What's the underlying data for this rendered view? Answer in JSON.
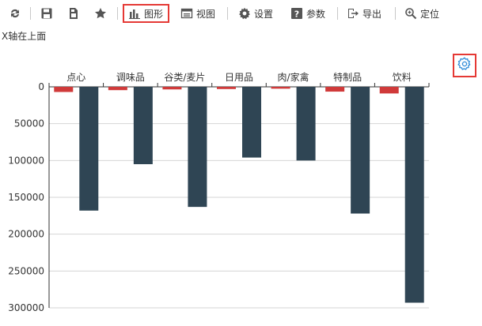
{
  "toolbar": {
    "refresh_icon": "refresh-icon",
    "save_icon": "save-icon",
    "save_as_icon": "save-as-icon",
    "favorite_icon": "star-icon",
    "chart_label": "图形",
    "view_label": "视图",
    "settings_label": "设置",
    "params_label": "参数",
    "export_label": "导出",
    "locate_label": "定位",
    "active_item": "图形"
  },
  "subtitle": "X轴在上面",
  "colors": {
    "series_a": "#d03a3a",
    "series_b": "#2f4554",
    "highlight": "#e53935",
    "gear": "#2e8bd8"
  },
  "chart_data": {
    "type": "bar",
    "x_axis_position": "top",
    "categories": [
      "点心",
      "调味品",
      "谷类/麦片",
      "日用品",
      "肉/家禽",
      "特制品",
      "饮料"
    ],
    "series": [
      {
        "values": [
          7000,
          4500,
          3500,
          3000,
          2500,
          6500,
          9000
        ]
      },
      {
        "values": [
          168000,
          105000,
          163000,
          96000,
          100000,
          172000,
          293000
        ]
      }
    ],
    "ylim": [
      0,
      300000
    ],
    "yticks": [
      0,
      50000,
      100000,
      150000,
      200000,
      250000,
      300000
    ],
    "y_inverted": true,
    "grid": true,
    "title": "",
    "xlabel": "",
    "ylabel": ""
  }
}
